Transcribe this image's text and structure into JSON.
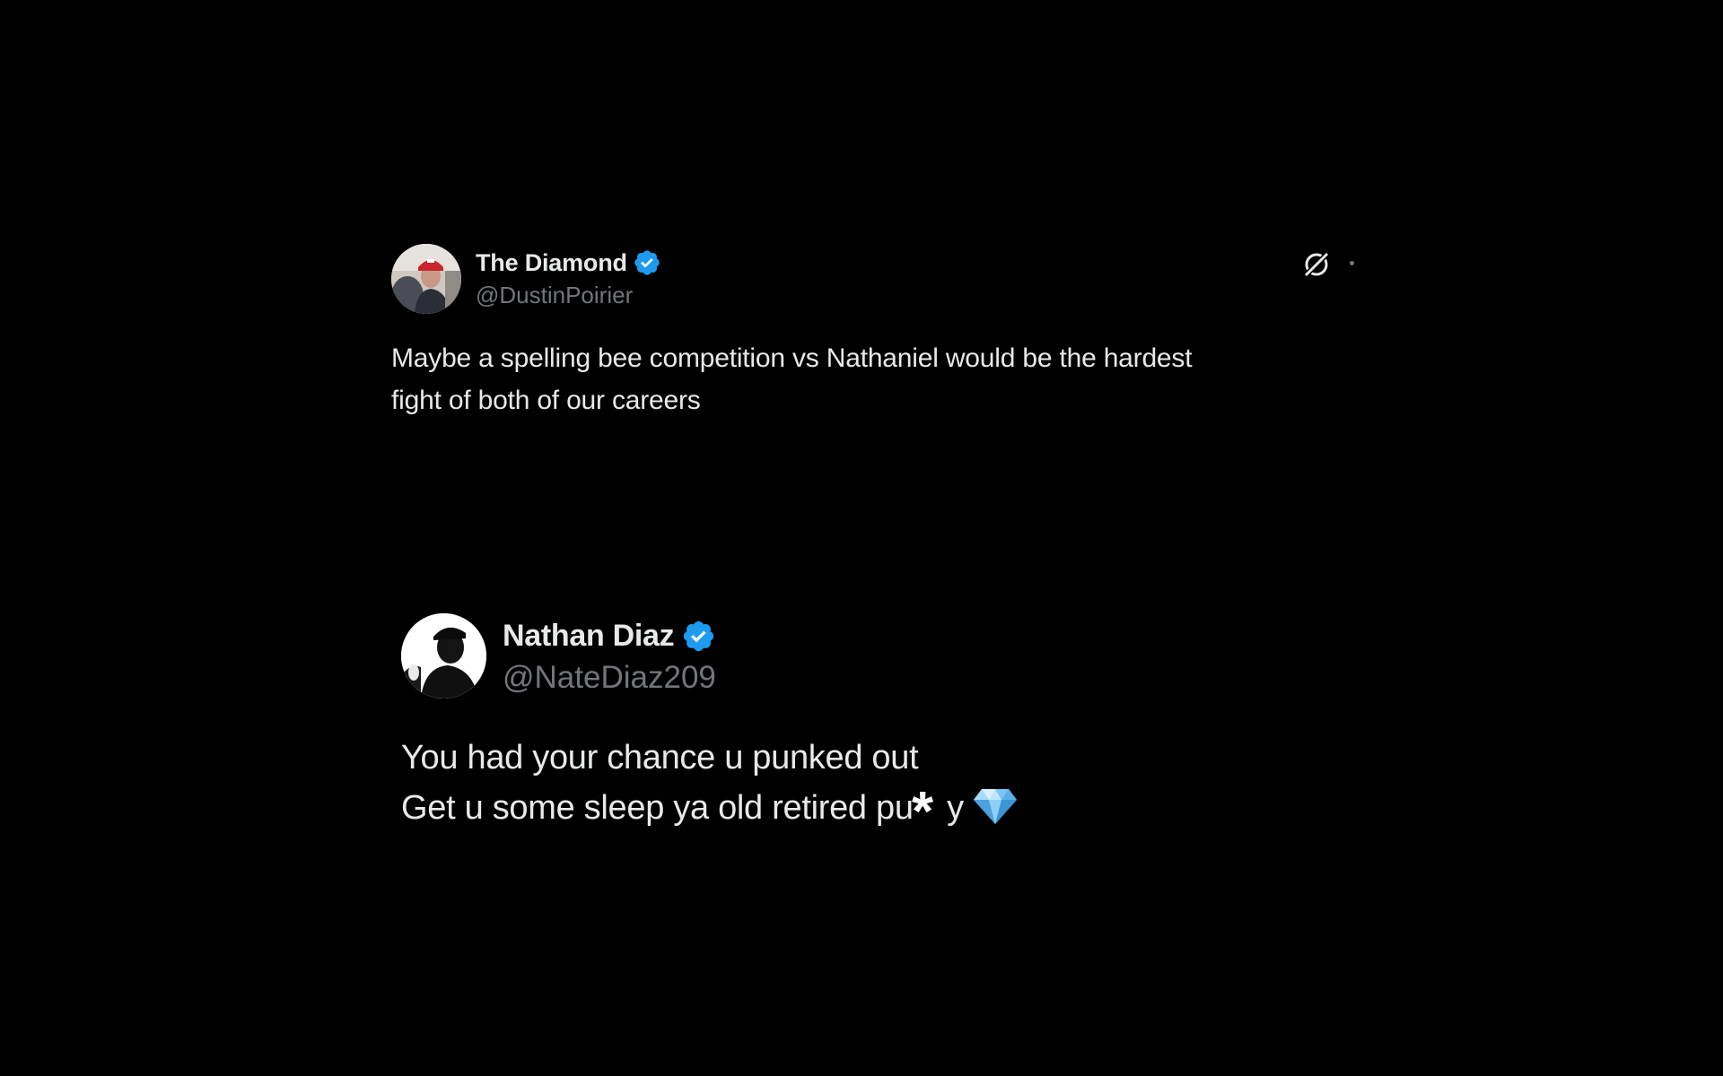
{
  "tweets": [
    {
      "display_name": "The Diamond",
      "handle": "@DustinPoirier",
      "verified": true,
      "text_lines": [
        "Maybe a spelling bee competition vs Nathaniel would be the hardest",
        "fight of both of our careers"
      ],
      "icons": [
        "verified-badge-icon",
        "grok-icon",
        "more-dot-icon"
      ]
    },
    {
      "display_name": "Nathan Diaz",
      "handle": "@NateDiaz209",
      "verified": true,
      "text_lines": [
        "You had your chance u punked out",
        "Get u some sleep ya old retired pu**y"
      ],
      "line2_start": "Get u some sleep ya old retired pu",
      "line2_end": "y",
      "censor_char": "*",
      "icons": [
        "verified-badge-icon",
        "gem-emoji-icon"
      ]
    }
  ],
  "colors": {
    "background": "#000000",
    "text_primary": "#e7e9ea",
    "text_secondary": "#71767b",
    "verified_blue": "#1d9bf0"
  }
}
